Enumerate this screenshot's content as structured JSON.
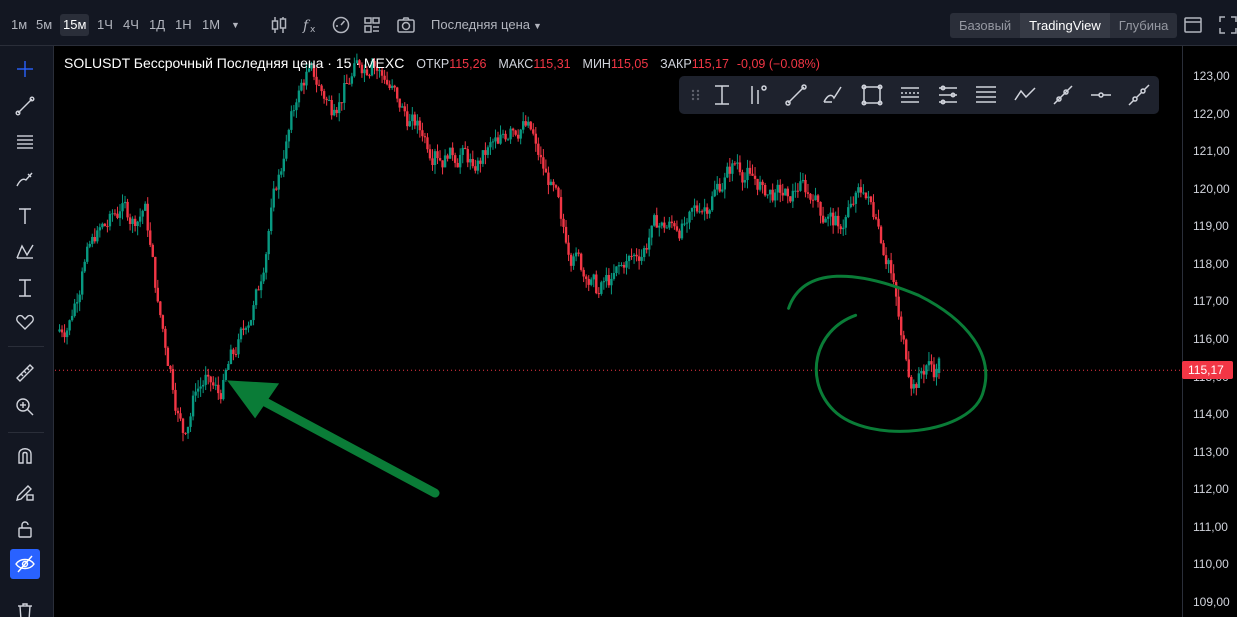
{
  "timeframes": [
    "1м",
    "5м",
    "15м",
    "1Ч",
    "4Ч",
    "1Д",
    "1Н",
    "1М"
  ],
  "active_timeframe": "15м",
  "price_source": "Последняя цена",
  "view_modes": [
    "Базовый",
    "TradingView",
    "Глубина"
  ],
  "active_view": "TradingView",
  "legend": {
    "symbol": "SOLUSDT Бессрочный Последняя цена · 15 · MEXC",
    "open_label": "ОТКР",
    "open": "115,26",
    "high_label": "МАКС",
    "high": "115,31",
    "low_label": "МИН",
    "low": "115,05",
    "close_label": "ЗАКР",
    "close": "115,17",
    "change": "-0,09 (−0.08%)"
  },
  "last_price_tag": "115,17",
  "colors": {
    "up": "#089981",
    "down": "#f23645",
    "annotation": "#0a7c37",
    "background": "#000000"
  },
  "chart_data": {
    "type": "candlestick",
    "y_ticks": [
      "123,00",
      "122,00",
      "121,00",
      "120,00",
      "119,00",
      "118,00",
      "117,00",
      "116,00",
      "115,00",
      "114,00",
      "113,00",
      "112,00",
      "111,00",
      "110,00",
      "109,00"
    ],
    "ylim": [
      108.6,
      123.8
    ],
    "last_price": 115.17,
    "closes": [
      116.5,
      117.8,
      118.6,
      119.0,
      119.4,
      119.2,
      119.6,
      117.0,
      115.2,
      113.5,
      114.6,
      115.0,
      114.4,
      115.6,
      116.3,
      117.3,
      119.5,
      120.8,
      122.3,
      123.2,
      122.6,
      122.1,
      122.8,
      123.3,
      123.4,
      122.9,
      122.4,
      121.8,
      121.4,
      121.0,
      120.8,
      120.9,
      120.6,
      120.9,
      121.2,
      121.6,
      121.8,
      121.2,
      120.1,
      119.2,
      118.2,
      117.6,
      117.2,
      117.6,
      117.9,
      118.2,
      118.7,
      119.1,
      119.0,
      119.1,
      119.4,
      119.8,
      120.3,
      120.7,
      120.4,
      120.1,
      119.9,
      119.8,
      120.2,
      119.7,
      119.2,
      119.0,
      119.6,
      119.9,
      119.2,
      118.1,
      116.1,
      114.8,
      115.3,
      115.1,
      115.2
    ],
    "markers": [
      {
        "type": "arrow",
        "color": "green",
        "from": [
          30,
          111.9
        ],
        "to": [
          13.5,
          114.9
        ]
      },
      {
        "type": "circle",
        "color": "green",
        "center": [
          66,
          115.3
        ]
      }
    ]
  }
}
